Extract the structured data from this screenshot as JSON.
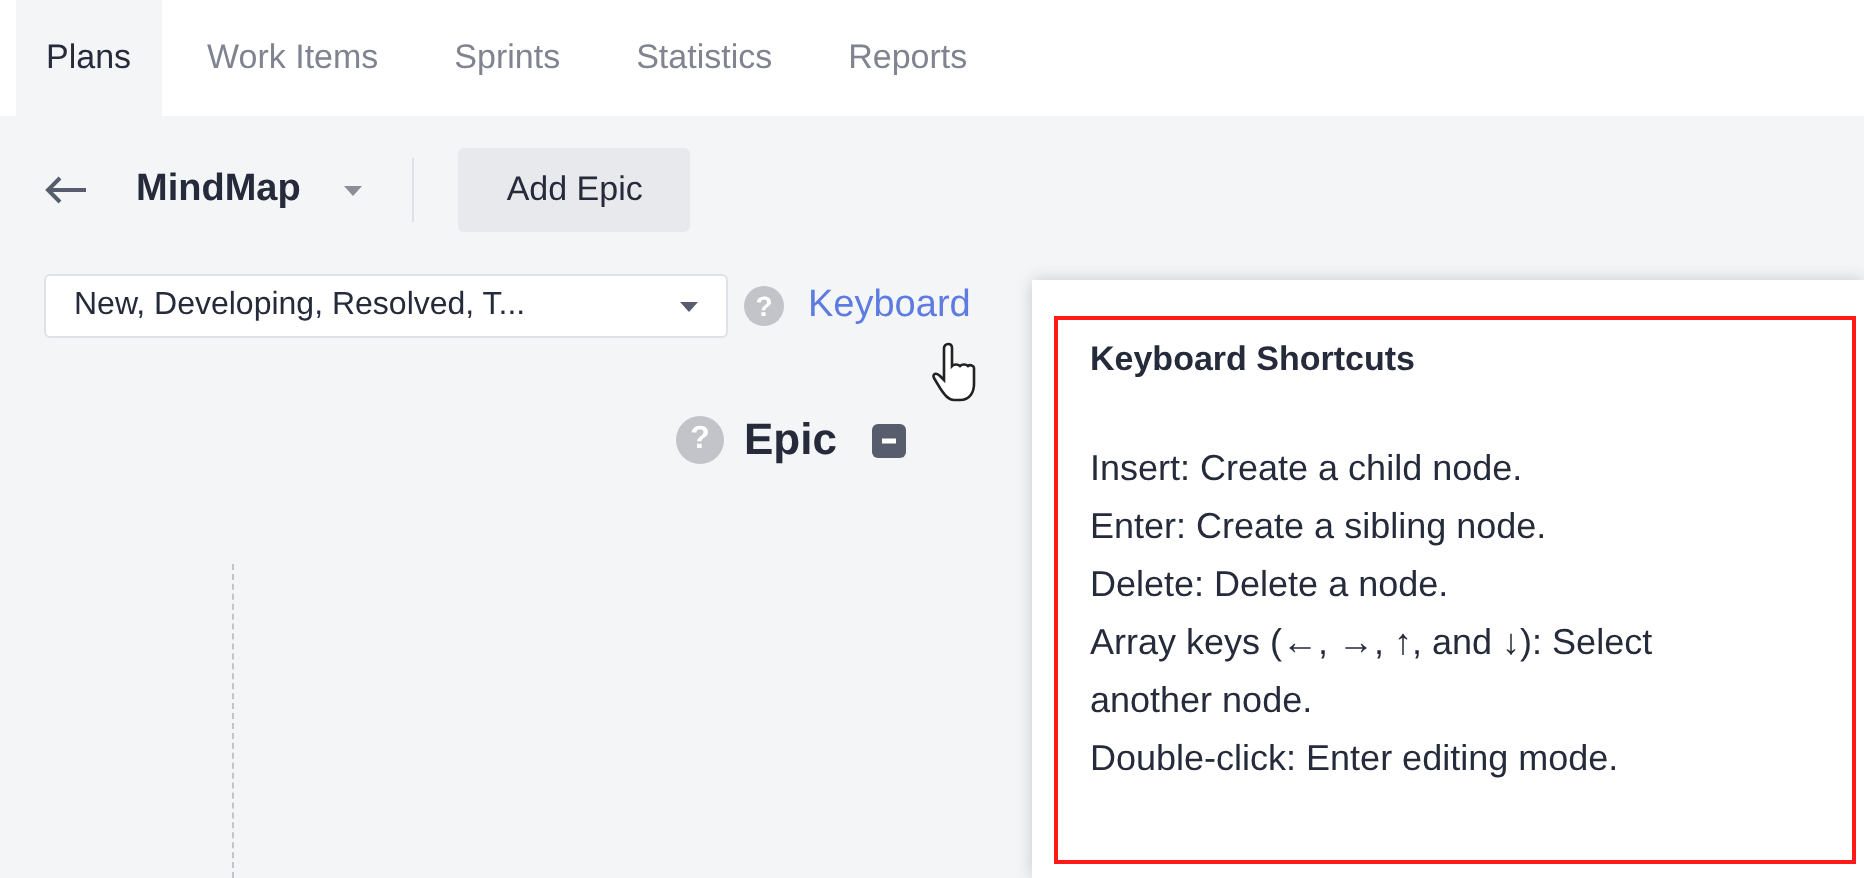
{
  "tabs": [
    {
      "label": "Plans",
      "selected": true
    },
    {
      "label": "Work Items",
      "selected": false
    },
    {
      "label": "Sprints",
      "selected": false
    },
    {
      "label": "Statistics",
      "selected": false
    },
    {
      "label": "Reports",
      "selected": false
    }
  ],
  "toolbar": {
    "title": "MindMap",
    "add_button": "Add Epic"
  },
  "filter": {
    "value": "New, Developing, Resolved, T..."
  },
  "filter_help": "?",
  "shortcuts_link": "Keyboard",
  "mindmap": {
    "help": "?",
    "root": "Epic",
    "expanded": true
  },
  "popover": {
    "title": "Keyboard Shortcuts",
    "highlighted": true,
    "lines": [
      "Insert: Create a child node.",
      "Enter: Create a sibling node.",
      "Delete: Delete a node.",
      "Array keys (←, →, ↑, and ↓): Select another node.",
      "Double-click: Enter editing mode."
    ]
  }
}
